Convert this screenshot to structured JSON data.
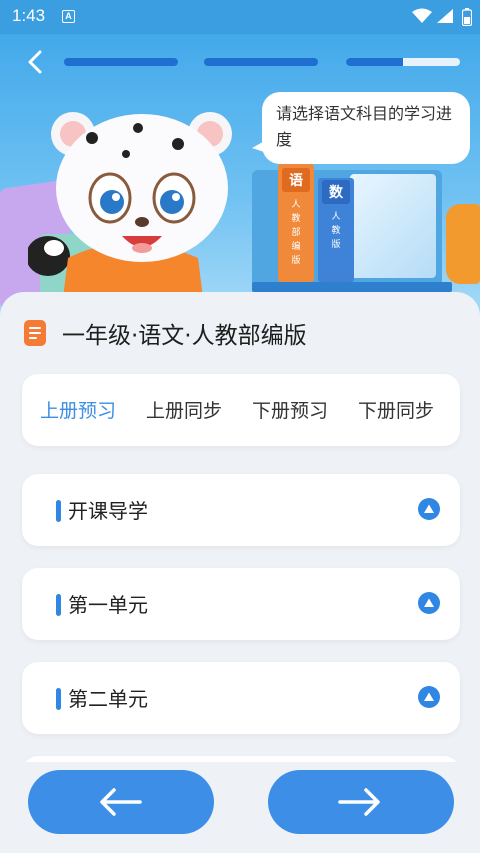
{
  "status_bar": {
    "time": "1:43",
    "app_icon_letter": "A"
  },
  "header": {
    "progress": [
      1.0,
      1.0,
      0.5
    ],
    "speech_bubble": "请选择语文科目的学习进度",
    "books": {
      "chinese_title": "语",
      "chinese_sub": "人教部编版",
      "math_title": "数",
      "math_sub": "人教版"
    }
  },
  "main": {
    "title": "一年级·语文·人教部编版",
    "tabs": [
      {
        "label": "上册预习",
        "active": true
      },
      {
        "label": "上册同步",
        "active": false
      },
      {
        "label": "下册预习",
        "active": false
      },
      {
        "label": "下册同步",
        "active": false
      }
    ],
    "units": [
      {
        "name": "开课导学"
      },
      {
        "name": "第一单元"
      },
      {
        "name": "第二单元"
      }
    ]
  },
  "colors": {
    "accent": "#3c8ee6",
    "status_bar": "#3a9ee0",
    "doc_icon": "#f47a35"
  },
  "icons": {
    "back": "chevron-left-icon",
    "prev": "arrow-left-icon",
    "next": "arrow-right-icon",
    "expand": "triangle-up-icon"
  }
}
